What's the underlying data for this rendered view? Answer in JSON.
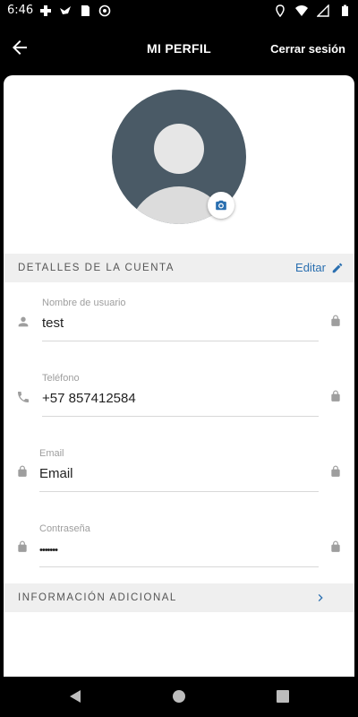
{
  "status_bar": {
    "time": "6:46"
  },
  "header": {
    "title": "MI PERFIL",
    "logout_label": "Cerrar sesión"
  },
  "account_section": {
    "title": "DETALLES DE LA CUENTA",
    "edit_label": "Editar"
  },
  "fields": [
    {
      "label": "Nombre de usuario",
      "value": "test"
    },
    {
      "label": "Teléfono",
      "value": "+57 857412584"
    },
    {
      "label": "Email",
      "value": "Email"
    },
    {
      "label": "Contraseña",
      "value": "•••••••"
    }
  ],
  "additional_section": {
    "title": "INFORMACIÓN ADICIONAL"
  },
  "colors": {
    "accent": "#2a6fb0",
    "section_bg": "#efefef",
    "avatar_bg": "#4a5a66"
  }
}
